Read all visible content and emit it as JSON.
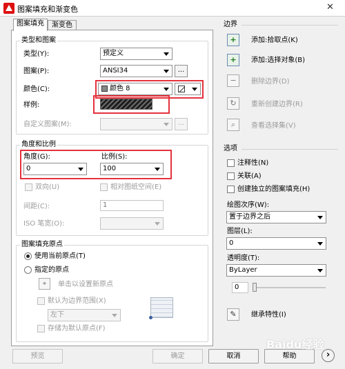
{
  "window": {
    "title": "图案填充和渐变色",
    "close_glyph": "✕"
  },
  "tabs": [
    "图案填充",
    "渐变色"
  ],
  "type_pattern": {
    "title": "类型和图案",
    "type_label": "类型(Y):",
    "type_value": "预定义",
    "pattern_label": "图案(P):",
    "pattern_value": "ANSI34",
    "pattern_browse": "...",
    "color_label": "颜色(C):",
    "color_value": "颜色 8",
    "color_swatch": "#888888",
    "sample_label": "样例:",
    "custom_label": "自定义图案(M):",
    "custom_value": "",
    "custom_browse": "..."
  },
  "angle_scale": {
    "title": "角度和比例",
    "angle_label": "角度(G):",
    "angle_value": "0",
    "scale_label": "比例(S):",
    "scale_value": "100",
    "double_label": "双向(U)",
    "relative_label": "相对图纸空间(E)",
    "spacing_label": "间距(C):",
    "spacing_value": "1",
    "iso_label": "ISO 笔宽(O):",
    "iso_value": ""
  },
  "origin": {
    "title": "图案填充原点",
    "use_current": "使用当前原点(T)",
    "specified": "指定的原点",
    "click_set": "单击以设置新原点",
    "default_extent": "默认为边界范围(X)",
    "extent_value": "左下",
    "store_default": "存储为默认原点(F)"
  },
  "boundaries": {
    "title": "边界",
    "add_pick": "添加:拾取点(K)",
    "add_select": "添加:选择对象(B)",
    "remove": "删除边界(D)",
    "recreate": "重新创建边界(R)",
    "view": "查看选择集(V)"
  },
  "options": {
    "title": "选项",
    "annotative": "注释性(N)",
    "associative": "关联(A)",
    "separate": "创建独立的图案填充(H)",
    "draw_order_label": "绘图次序(W):",
    "draw_order_value": "置于边界之后",
    "layer_label": "图层(L):",
    "layer_value": "0",
    "transparency_label": "透明度(T):",
    "transparency_value": "ByLayer",
    "transparency_number": "0"
  },
  "inherit": "继承特性(I)",
  "buttons": {
    "preview": "预览",
    "ok": "确定",
    "cancel": "取消",
    "help": "帮助",
    "more": "›"
  },
  "watermark": "Baidu经验"
}
